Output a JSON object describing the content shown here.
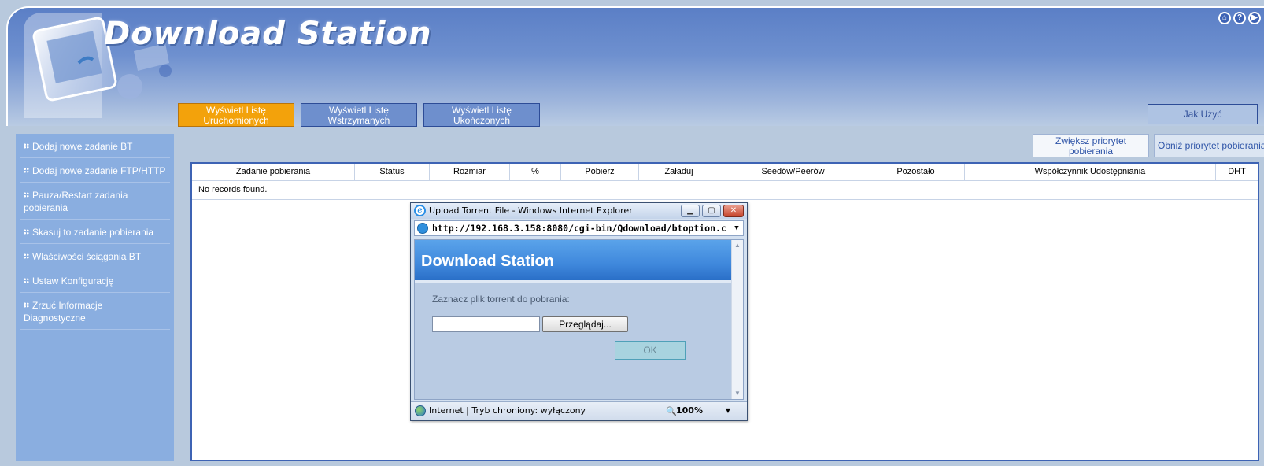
{
  "header": {
    "title": "Download Station",
    "top_icons": [
      "home-icon",
      "help-icon",
      "play-icon"
    ],
    "tabs": [
      {
        "line1": "Wyświetl Listę",
        "line2": "Uruchomionych",
        "active": true
      },
      {
        "line1": "Wyświetl Listę",
        "line2": "Wstrzymanych",
        "active": false
      },
      {
        "line1": "Wyświetl Listę",
        "line2": "Ukończonych",
        "active": false
      }
    ],
    "help_label": "Jak Użyć"
  },
  "priority": {
    "increase_line1": "Zwiększ priorytet",
    "increase_line2": "pobierania",
    "decrease": "Obniż priorytet pobierania"
  },
  "sidebar": {
    "items": [
      {
        "label": "Dodaj nowe zadanie BT"
      },
      {
        "label": "Dodaj nowe zadanie FTP/HTTP"
      },
      {
        "label": "Pauza/Restart zadania pobierania"
      },
      {
        "label": "Skasuj to zadanie pobierania"
      },
      {
        "label": "Właściwości ściągania BT"
      },
      {
        "label": "Ustaw Konfigurację"
      },
      {
        "label": "Zrzuć Informacje Diagnostyczne"
      }
    ]
  },
  "table": {
    "columns": [
      {
        "label": "Zadanie pobierania"
      },
      {
        "label": "Status"
      },
      {
        "label": "Rozmiar"
      },
      {
        "label": "%"
      },
      {
        "label": "Pobierz"
      },
      {
        "label": "Załaduj"
      },
      {
        "label": "Seedów/Peerów"
      },
      {
        "label": "Pozostało"
      },
      {
        "label": "Współczynnik Udostępniania"
      },
      {
        "label": "DHT"
      }
    ],
    "empty_message": "No records found."
  },
  "popup": {
    "window_title": "Upload Torrent File - Windows Internet Explorer",
    "address": "http://192.168.3.158:8080/cgi-bin/Qdownload/btoption.c",
    "page_title": "Download Station",
    "prompt": "Zaznacz plik torrent do pobrania:",
    "file_value": "",
    "browse_label": "Przeglądaj...",
    "ok_label": "OK",
    "status_text": "Internet | Tryb chroniony: wyłączony",
    "zoom": "100%"
  },
  "colors": {
    "header_blue": "#5b7fc6",
    "active_tab": "#f3a20b",
    "sidebar": "#8aaee0",
    "panel_border": "#3d63b4"
  }
}
